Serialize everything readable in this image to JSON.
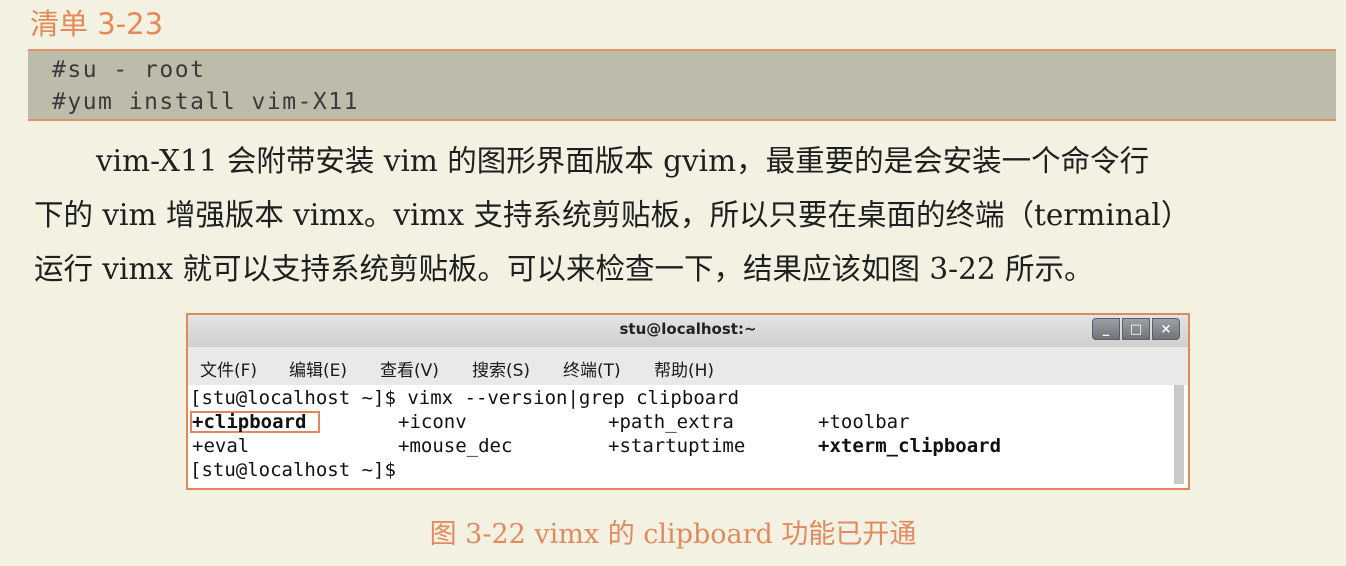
{
  "listing_title": "清单 3-23",
  "code": {
    "line1": "#su - root",
    "line2": "#yum install vim-X11"
  },
  "paragraph": {
    "line1": "vim-X11 会附带安装 vim 的图形界面版本 gvim，最重要的是会安装一个命令行",
    "line2": "下的 vim 增强版本 vimx。vimx 支持系统剪贴板，所以只要在桌面的终端（terminal）",
    "line3": "运行 vimx 就可以支持系统剪贴板。可以来检查一下，结果应该如图 3-22 所示。"
  },
  "terminal": {
    "title": "stu@localhost:~",
    "controls": {
      "minimize": "_",
      "maximize": "□",
      "close": "×"
    },
    "menu": [
      "文件(F)",
      "编辑(E)",
      "查看(V)",
      "搜索(S)",
      "终端(T)",
      "帮助(H)"
    ],
    "command_line": "[stu@localhost ~]$ vimx --version|grep clipboard",
    "output_rows": [
      [
        "+clipboard",
        "+iconv",
        "+path_extra",
        "+toolbar"
      ],
      [
        "+eval",
        "+mouse_dec",
        "+startuptime",
        "+xterm_clipboard"
      ]
    ],
    "prompt_line": "[stu@localhost ~]$"
  },
  "caption": "图 3-22    vimx 的 clipboard 功能已开通"
}
